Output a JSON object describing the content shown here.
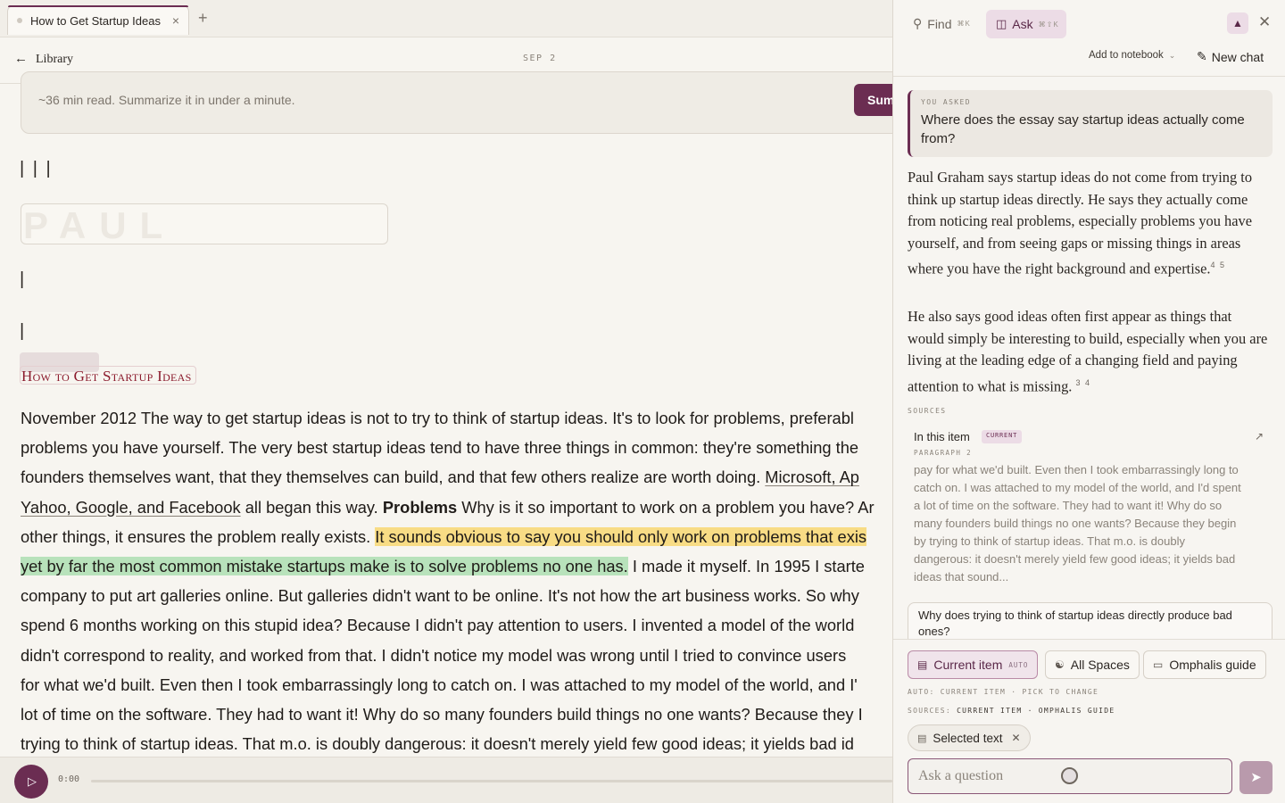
{
  "tab": {
    "title": "How to Get Startup Ideas",
    "close": "×",
    "add": "+"
  },
  "nav": {
    "back_arrow": "←",
    "back_label": "Library",
    "date": "SEP 2"
  },
  "summary": {
    "text": "~36 min read. Summarize it in under a minute.",
    "button": "Sum"
  },
  "article": {
    "bars_top": "| | |",
    "banner_text": "PAUL GRAHAM",
    "bar_a": "|",
    "bar_b": "|",
    "title": "How to Get Startup Ideas",
    "lines": [
      [
        "November 2012 The way to get startup ideas is not to try to think of startup ideas. It's to look for problems, preferabl"
      ],
      [
        "problems you have yourself. The very best startup ideas tend to have three things in common: they're something the"
      ],
      [
        "founders themselves want, that they themselves can build, and that few others realize are worth doing. ",
        "Microsoft, Ap"
      ],
      [
        "Yahoo, Google, and Facebook",
        " all began this way. ",
        "Problems",
        " Why is it so important to work on a problem you have? Ar"
      ],
      [
        "other things, it ensures the problem really exists. ",
        "It sounds obvious to say you should only work on problems that exis"
      ],
      [
        "yet by far the most common mistake startups make is to solve problems no one has.",
        " I made it myself. In 1995 I starte"
      ],
      [
        "company to put art galleries online. But galleries didn't want to be online. It's not how the art business works. So why"
      ],
      [
        "spend 6 months working on this stupid idea? Because I didn't pay attention to users. I invented a model of the world"
      ],
      [
        "didn't correspond to reality, and worked from that. I didn't notice my model was wrong until I tried to convince users"
      ],
      [
        "for what we'd built. Even then I took embarrassingly long to catch on. I was attached to my model of the world, and I'"
      ],
      [
        "lot of time on the software. They had to want it! Why do so many founders build things no one wants? Because they I"
      ],
      [
        "trying to think of startup ideas. That m.o. is doubly dangerous: it doesn't merely yield few good ideas; it yields bad id"
      ]
    ]
  },
  "player": {
    "play_icon": "▷",
    "time": "0:00"
  },
  "panel": {
    "find_label": "Find",
    "find_kbd": "⌘K",
    "ask_label": "Ask",
    "ask_kbd": "⌘⇧K",
    "add_notebook": "Add to notebook",
    "new_chat": "New chat",
    "you_asked_label": "YOU ASKED",
    "question": "Where does the essay say startup ideas actually come from?",
    "answer_1": "Paul Graham says startup ideas do not come from trying to think up startup ideas directly. He says they actually come from noticing real problems, especially problems you have yourself, and from seeing gaps or missing things in areas where you have the right background and expertise.",
    "answer_1_refs": "4 5",
    "answer_2": "He also says good ideas often first appear as things that would simply be interesting to build, especially when you are living at the leading edge of a changing field and paying attention to what is missing.",
    "answer_2_refs": "3 4",
    "sources_label": "SOURCES",
    "source": {
      "title": "In this item",
      "badge": "CURRENT",
      "sub": "PARAGRAPH 2",
      "text": "pay for what we'd built. Even then I took embarrassingly long to catch on. I was attached to my model of the world, and I'd spent a lot of time on the software. They had to want it! Why do so many founders build things no one wants? Because they begin by trying to think of startup ideas. That m.o. is doubly dangerous: it doesn't merely yield few good ideas; it yields bad ideas that sound..."
    },
    "followup": "Why does trying to think of startup ideas directly produce bad ones?",
    "scope_chips": [
      {
        "label": "Current item",
        "tag": "AUTO"
      },
      {
        "label": "All Spaces"
      },
      {
        "label": "Omphalis guide"
      }
    ],
    "meta_1": "AUTO: CURRENT ITEM · PICK TO CHANGE",
    "meta_2_prefix": "SOURCES: ",
    "meta_2_value": "CURRENT ITEM · OMPHALIS GUIDE",
    "selected_chip": "Selected text",
    "input_placeholder": "Ask a question"
  },
  "colors": {
    "accent": "#6b2d52",
    "highlight_yellow": "#f8dc85",
    "highlight_green": "#b8e2bb",
    "title_red": "#8b1a2c"
  }
}
